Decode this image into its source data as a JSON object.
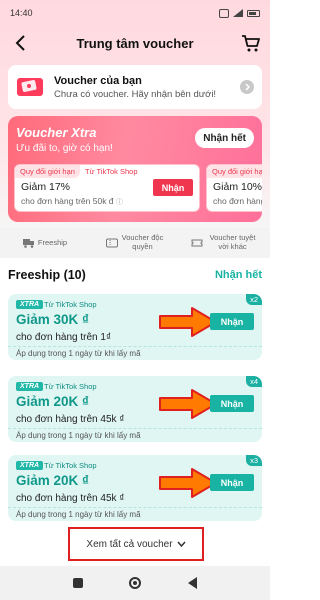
{
  "status_bar": {
    "time": "14:40"
  },
  "header": {
    "title": "Trung tâm voucher"
  },
  "my_voucher": {
    "title": "Voucher của bạn",
    "subtitle": "Chưa có voucher. Hãy nhận bên dưới!"
  },
  "xtra": {
    "title": "Voucher Xtra",
    "subtitle": "Ưu đãi to, giờ có hạn!",
    "claim_all": "Nhận hết",
    "cards": [
      {
        "tag": "Quy đổi giới hạn",
        "shop": "Từ TikTok Shop",
        "amount": "Giảm 17%",
        "condition": "cho đơn hàng trên 50k đ",
        "button": "Nhận"
      },
      {
        "tag": "Quy đổi giới hạn",
        "amount": "Giảm 10%",
        "condition": "cho đơn hàng"
      }
    ]
  },
  "categories": [
    {
      "label": "Freeship",
      "icon": "truck-icon"
    },
    {
      "label": "Voucher độc quyền",
      "icon": "voucher-icon"
    },
    {
      "label": "Voucher tuyệt vời khác",
      "icon": "ticket-icon"
    }
  ],
  "freeship": {
    "title": "Freeship (10)",
    "claim_all": "Nhận hết",
    "vouchers": [
      {
        "badge": "XTRA",
        "shop": "Từ TikTok Shop",
        "amount": "Giảm 30K ₫",
        "condition": "cho đơn hàng trên 1₫",
        "footer": "Áp dụng trong 1 ngày từ khi lấy mã",
        "button": "Nhận",
        "multiplier": "x2"
      },
      {
        "badge": "XTRA",
        "shop": "Từ TikTok Shop",
        "amount": "Giảm 20K ₫",
        "condition": "cho đơn hàng trên 45k ₫",
        "footer": "Áp dụng trong 1 ngày từ khi lấy mã",
        "button": "Nhận",
        "multiplier": "x4"
      },
      {
        "badge": "XTRA",
        "shop": "Từ TikTok Shop",
        "amount": "Giảm 20K ₫",
        "condition": "cho đơn hàng trên 45k ₫",
        "footer": "Áp dụng trong 1 ngày từ khi lấy mã",
        "button": "Nhận",
        "multiplier": "x3"
      }
    ],
    "see_all": "Xem tất cả voucher"
  },
  "colors": {
    "accent_pink": "#f0364f",
    "accent_teal": "#19b3a3",
    "annotation_arrow": "#ff6a00",
    "annotation_box": "#e02020"
  }
}
